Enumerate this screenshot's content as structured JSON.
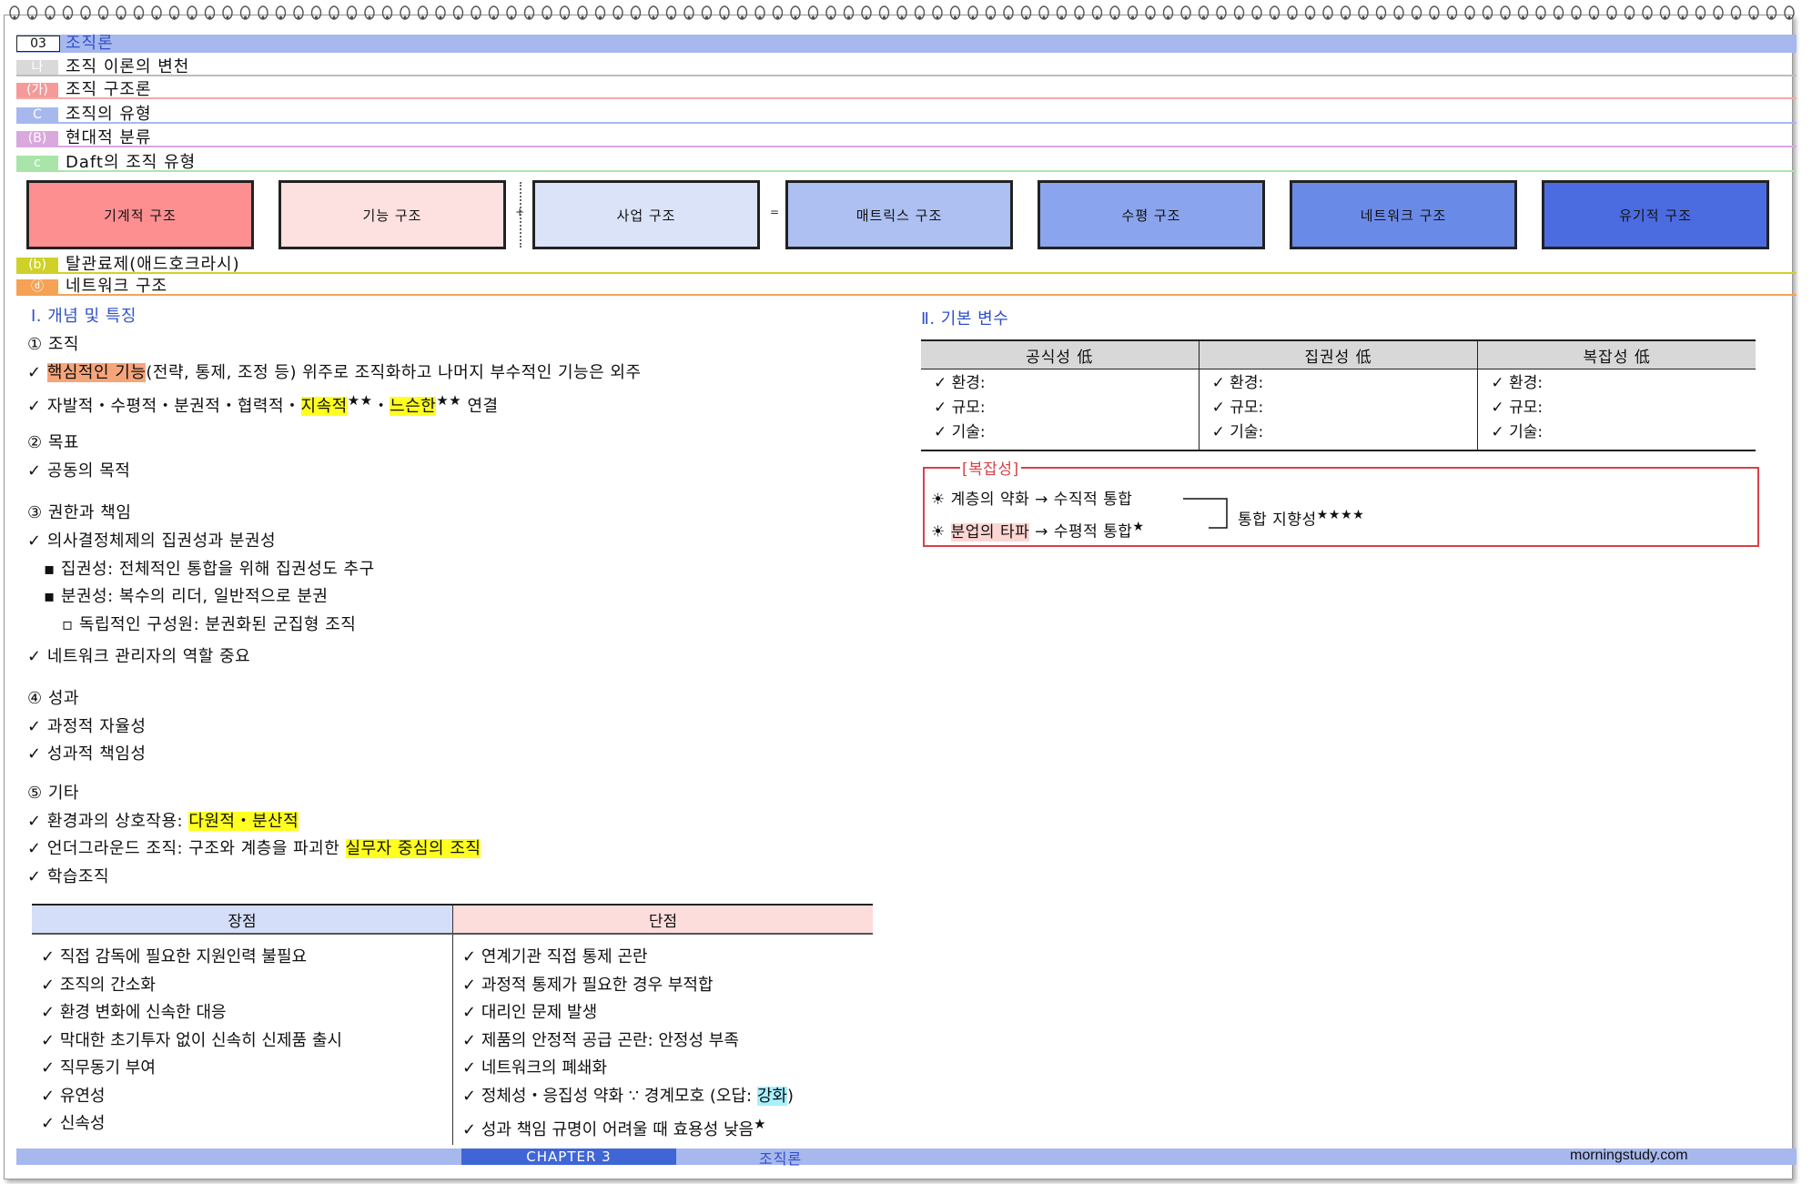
{
  "headers": [
    {
      "num": "03",
      "title": "조직론",
      "num_bg": "#ffffff",
      "num_border": "#222222",
      "bar_bg": "#a7b8ee",
      "title_color": "#3050c8"
    },
    {
      "num": "나",
      "title": "조직 이론의 변천",
      "num_bg": "#d9d9d9",
      "line": "#bdbdbd"
    },
    {
      "num": "(가)",
      "title": "조직 구조론",
      "num_bg": "#f59a98",
      "line": "#f2aaa8"
    },
    {
      "num": "C",
      "title": "조직의 유형",
      "num_bg": "#a7b8ee",
      "line": "#a7b8ee"
    },
    {
      "num": "(B)",
      "title": "현대적 분류",
      "num_bg": "#d9a8dc",
      "line": "#d9a8dc"
    },
    {
      "num": "c",
      "title": "Daft의 조직 유형",
      "num_bg": "#a9e5a9",
      "line": "#a9e5a9"
    },
    {
      "num": "(b)",
      "title": "탈관료제(애드호크라시)",
      "num_bg": "#cfd128",
      "line": "#cfd128"
    },
    {
      "num": "ⓓ",
      "title": "네트워크 구조",
      "num_bg": "#f5a255",
      "line": "#f5a255"
    }
  ],
  "structures": [
    {
      "label": "기계적 구조",
      "bg": "#fd8f91"
    },
    {
      "label": "기능 구조",
      "bg": "#fde0e0"
    },
    {
      "label": "사업 구조",
      "bg": "#dbe3f9"
    },
    {
      "label": "매트릭스 구조",
      "bg": "#adc0f1"
    },
    {
      "label": "수평 구조",
      "bg": "#8aa4ed"
    },
    {
      "label": "네트워크 구조",
      "bg": "#6a8ae8"
    },
    {
      "label": "유기적 구조",
      "bg": "#4b6ce0"
    }
  ],
  "operators": {
    "plus": "+",
    "equals": "="
  },
  "left": {
    "section_title": "Ⅰ. 개념 및 특징",
    "s1": {
      "title": "① 조직",
      "b1_hl": "핵심적인 기능",
      "b1_rest": "(전략, 통제, 조정 등) 위주로 조직화하고 나머지 부수적인 기능은 외주",
      "b2_a": "자발적・수평적・분권적・협력적・",
      "b2_hl1": "지속적",
      "b2_star1": "★★",
      "b2_mid": "・",
      "b2_hl2": "느슨한",
      "b2_star2": "★★",
      "b2_end": " 연결"
    },
    "s2": {
      "title": "② 목표",
      "b1": "공동의 목적"
    },
    "s3": {
      "title": "③ 권한과 책임",
      "b1": "의사결정체제의 집권성과 분권성",
      "sub1": "집권성: 전체적인 통합을 위해 집권성도 추구",
      "sub2": "분권성: 복수의 리더, 일반적으로 분권",
      "sub3": "독립적인 구성원: 분권화된 군집형 조직",
      "b2": "네트워크 관리자의 역할 중요"
    },
    "s4": {
      "title": "④ 성과",
      "b1": "과정적 자율성",
      "b2": "성과적 책임성"
    },
    "s5": {
      "title": "⑤ 기타",
      "b1_a": "환경과의 상호작용: ",
      "b1_hl": "다원적・분산적",
      "b2_a": "언더그라운드 조직: 구조와 계층을 파괴한 ",
      "b2_hl": "실무자 중심의 조직",
      "b3": "학습조직"
    }
  },
  "pros_cons": {
    "pros_header": "장점",
    "cons_header": "단점",
    "pros": [
      "직접 감독에 필요한 지원인력 불필요",
      "조직의 간소화",
      "환경 변화에 신속한 대응",
      "막대한 초기투자 없이 신속히 신제품 출시",
      "직무동기 부여",
      "유연성",
      "신속성"
    ],
    "cons": [
      "연계기관 직접 통제 곤란",
      "과정적 통제가 필요한 경우 부적합",
      "대리인 문제 발생",
      "제품의 안정적 공급 곤란: 안정성 부족",
      "네트워크의 폐쇄화"
    ],
    "cons6_a": "정체성・응집성 약화 ∵ 경계모호 (오답: ",
    "cons6_hl": "강화",
    "cons6_b": ")",
    "cons7": "성과 책임 규명이 어려울 때 효용성 낮음",
    "cons7_star": "★"
  },
  "right": {
    "section_title": "Ⅱ. 기본 변수",
    "columns": [
      "공식성 低",
      "집권성 低",
      "복잡성 低"
    ],
    "rows": [
      "환경:",
      "규모:",
      "기술:"
    ],
    "complexity": {
      "label": "[복잡성]",
      "line1": "계층의 약화 → 수직적 통합",
      "line2_hl": "분업의 타파",
      "line2_rest": " → 수평적 통합",
      "line2_star": "★",
      "result": "통합 지향성",
      "result_stars": "★★★★"
    }
  },
  "footer": {
    "chapter": "CHAPTER 3",
    "title": "조직론",
    "site": "morningstudy.com"
  },
  "colors": {
    "accent_blue": "#3050c8",
    "footer_bar": "#a7b8ee",
    "chapter_box": "#3f66d6",
    "box_border": "#d94148"
  }
}
